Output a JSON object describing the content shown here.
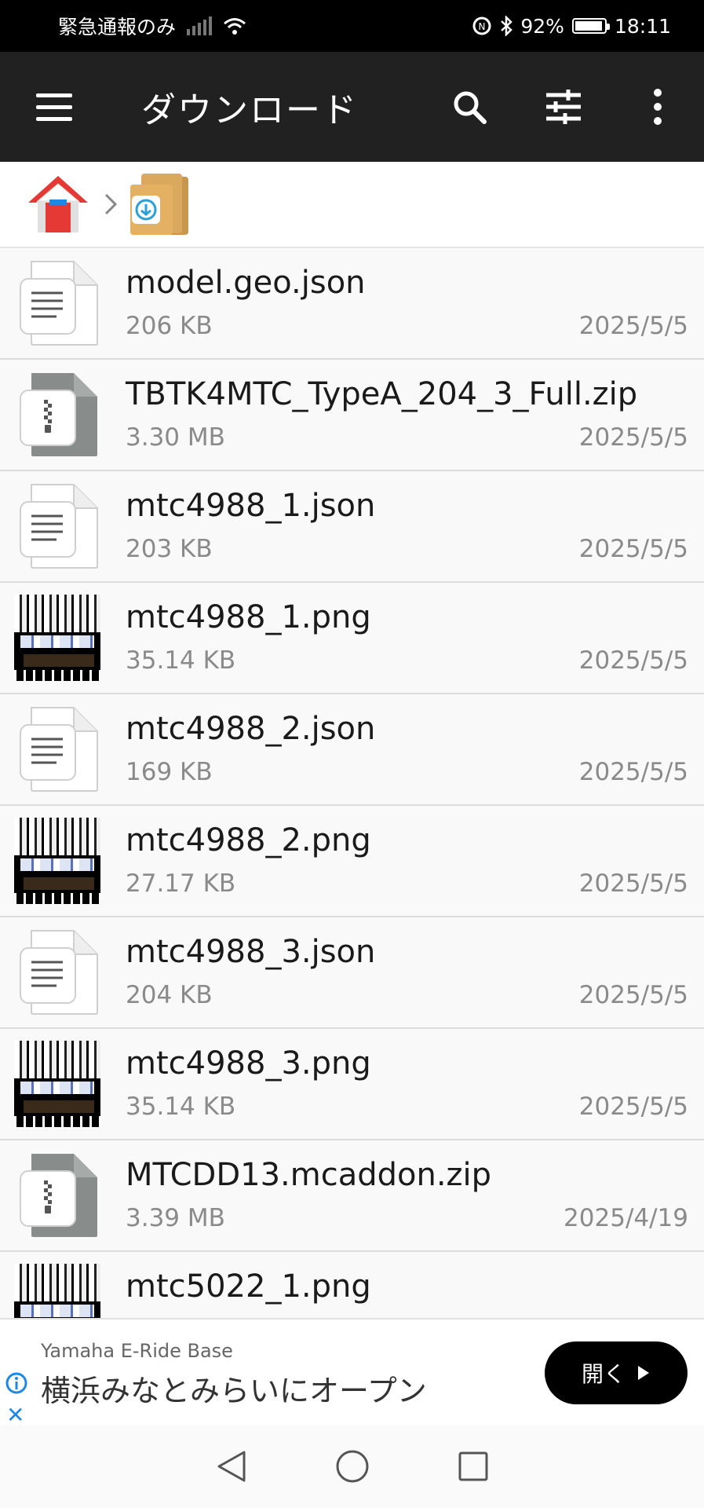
{
  "status_bar": {
    "carrier_text": "緊急通報のみ",
    "battery_percent": "92%",
    "time": "18:11"
  },
  "toolbar": {
    "title": "ダウンロード",
    "icons": [
      "menu-icon",
      "search-icon",
      "filter-icon",
      "more-vert-icon"
    ]
  },
  "breadcrumb": {
    "items": [
      "home-icon",
      "downloads-folder-icon"
    ]
  },
  "files": [
    {
      "name": "model.geo.json",
      "size": "206 KB",
      "date": "2025/5/5",
      "kind": "text"
    },
    {
      "name": "TBTK4MTC_TypeA_204_3_Full.zip",
      "size": "3.30 MB",
      "date": "2025/5/5",
      "kind": "zip"
    },
    {
      "name": "mtc4988_1.json",
      "size": "203 KB",
      "date": "2025/5/5",
      "kind": "text"
    },
    {
      "name": "mtc4988_1.png",
      "size": "35.14 KB",
      "date": "2025/5/5",
      "kind": "image"
    },
    {
      "name": "mtc4988_2.json",
      "size": "169 KB",
      "date": "2025/5/5",
      "kind": "text"
    },
    {
      "name": "mtc4988_2.png",
      "size": "27.17 KB",
      "date": "2025/5/5",
      "kind": "image"
    },
    {
      "name": "mtc4988_3.json",
      "size": "204 KB",
      "date": "2025/5/5",
      "kind": "text"
    },
    {
      "name": "mtc4988_3.png",
      "size": "35.14 KB",
      "date": "2025/5/5",
      "kind": "image"
    },
    {
      "name": "MTCDD13.mcaddon.zip",
      "size": "3.39 MB",
      "date": "2025/4/19",
      "kind": "zip"
    },
    {
      "name": "mtc5022_1.png",
      "size": "",
      "date": "",
      "kind": "image"
    }
  ],
  "ad": {
    "sponsor": "Yamaha E-Ride Base",
    "headline": "横浜みなとみらいにオープン",
    "button_label": "開く"
  },
  "colors": {
    "toolbar_bg": "#212121",
    "status_bg": "#000000",
    "list_bg": "#f9f9f9",
    "ad_accent": "#1e88e5"
  }
}
